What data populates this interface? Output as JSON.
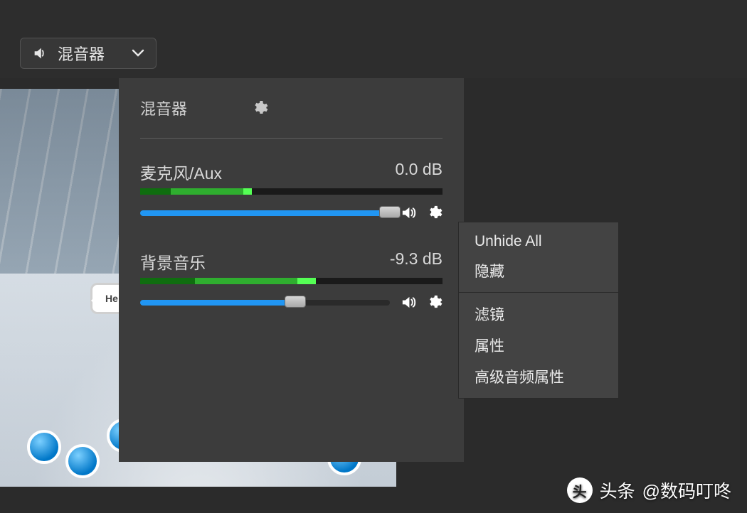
{
  "dropdown": {
    "label": "混音器"
  },
  "mixer": {
    "title": "混音器",
    "channels": [
      {
        "name": "麦克风/Aux",
        "db": "0.0 dB",
        "meter_pct": [
          10,
          24,
          3
        ],
        "slider_pct": 100
      },
      {
        "name": "背景音乐",
        "db": "-9.3 dB",
        "meter_pct": [
          18,
          34,
          6
        ],
        "slider_pct": 62
      }
    ]
  },
  "context_menu": {
    "items_group1": [
      "Unhide All",
      "隐藏"
    ],
    "items_group2": [
      "滤镜",
      "属性",
      "高级音频属性"
    ]
  },
  "watermark": {
    "prefix": "头条",
    "account": "@数码叮咚"
  },
  "colors": {
    "panel": "#3c3c3c",
    "accent": "#2196f3",
    "meter_dark": "#0f6d0f",
    "meter_mid": "#2fae2f",
    "meter_light": "#55ff55"
  }
}
